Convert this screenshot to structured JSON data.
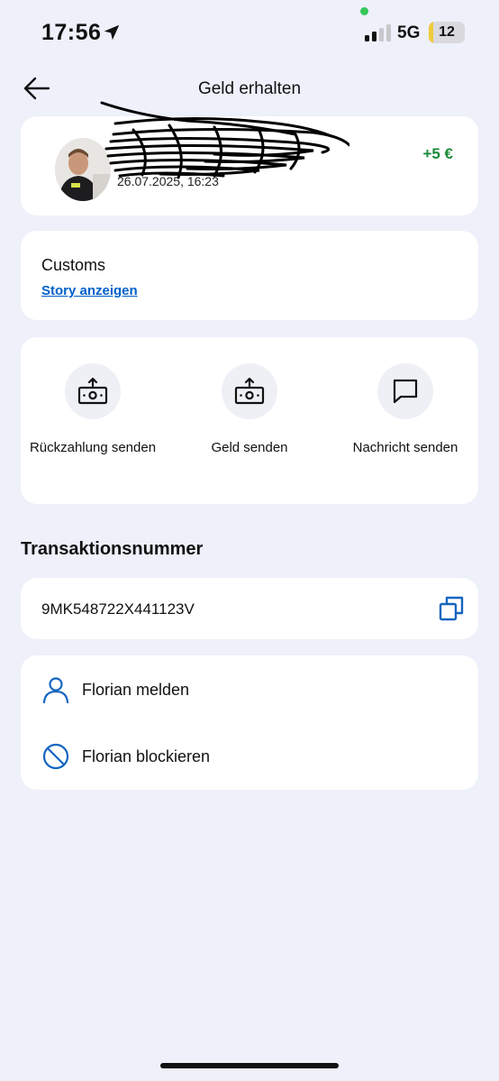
{
  "status_bar": {
    "time": "17:56",
    "network": "5G",
    "battery": "12",
    "battery_level": 0.12
  },
  "header": {
    "title": "Geld erhalten"
  },
  "sender": {
    "name": "",
    "date": "26.07.2025, 16:23",
    "amount": "+5 €"
  },
  "note": {
    "text": "Customs",
    "story_link": "Story anzeigen"
  },
  "actions": [
    {
      "label": "Rückzahlung senden",
      "icon": "money-send-icon"
    },
    {
      "label": "Geld senden",
      "icon": "money-send-icon"
    },
    {
      "label": "Nachricht senden",
      "icon": "chat-bubble-icon"
    }
  ],
  "transaction": {
    "section_title": "Transaktionsnummer",
    "number": "9MK548722X441123V",
    "copy_icon": "copy-icon"
  },
  "report": {
    "report_label": "Florian melden",
    "report_icon": "person-icon",
    "block_label": "Florian blockieren",
    "block_icon": "block-icon"
  },
  "colors": {
    "background": "#eef0fa",
    "card": "#ffffff",
    "positive": "#1b8a3a",
    "link": "#0060c9",
    "icon_blue": "#1565c0"
  }
}
